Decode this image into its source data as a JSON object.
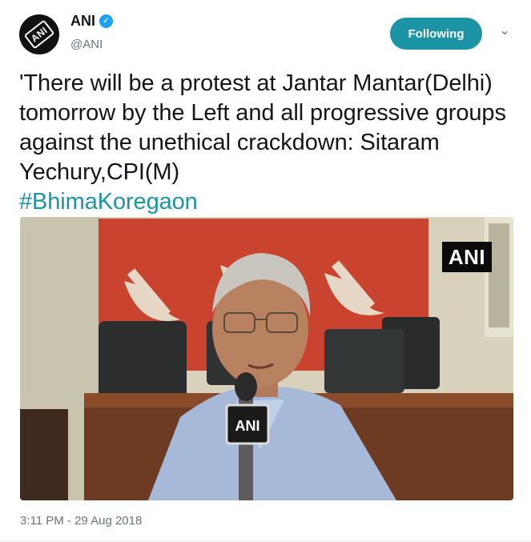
{
  "author": {
    "display_name": "ANI",
    "handle": "@ANI",
    "verified": true,
    "avatar_logo_text": "ANI"
  },
  "follow_button": {
    "label": "Following",
    "color": "#1b95a5"
  },
  "menu": {
    "icon": "chevron-down-icon"
  },
  "tweet": {
    "text": "'There will be a protest at Jantar Mantar(Delhi) tomorrow by the Left and all progressive groups against the unethical crackdown: Sitaram Yechury,CPI(M)",
    "hashtag": "#BhimaKoregaon",
    "hashtag_color": "#1b95a5"
  },
  "media": {
    "watermark": "ANI",
    "mic_label": "ANI"
  },
  "timestamp": "3:11 PM - 29 Aug 2018"
}
